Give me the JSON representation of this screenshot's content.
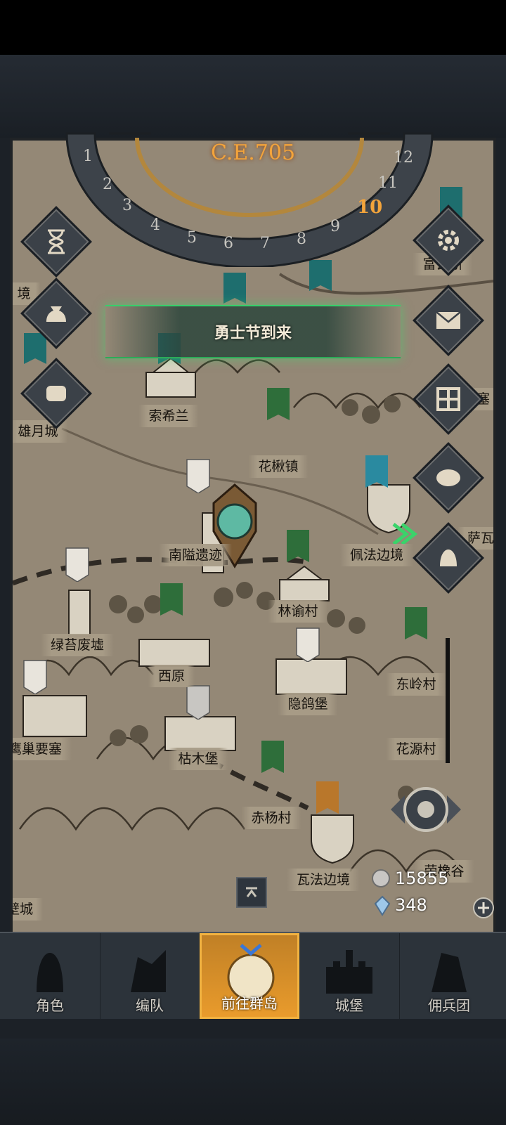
{
  "header": {
    "year": "C.E.705",
    "months": [
      "1",
      "2",
      "3",
      "4",
      "5",
      "6",
      "7",
      "8",
      "9",
      "10",
      "11",
      "12"
    ],
    "current_month": "10"
  },
  "event": {
    "title": "勇士节到来"
  },
  "places": [
    {
      "id": "fu_shi",
      "name": "富瓦斯"
    },
    {
      "id": "jing",
      "name": "境"
    },
    {
      "id": "suo_xi_lan",
      "name": "索希兰"
    },
    {
      "id": "xiong_yue_cheng",
      "name": "雄月城"
    },
    {
      "id": "yao_sai",
      "name": "要塞"
    },
    {
      "id": "hua_qiu_zhen",
      "name": "花楸镇"
    },
    {
      "id": "nan_yi",
      "name": "南隘遗迹"
    },
    {
      "id": "pei_fa",
      "name": "佩法边境"
    },
    {
      "id": "sa",
      "name": "萨瓦"
    },
    {
      "id": "lin_yu",
      "name": "林谕村"
    },
    {
      "id": "lv_tai",
      "name": "绿苔废墟"
    },
    {
      "id": "xi_yuan",
      "name": "西原"
    },
    {
      "id": "dong_ling",
      "name": "东岭村"
    },
    {
      "id": "yin_ge",
      "name": "隐鸽堡"
    },
    {
      "id": "ying_chao",
      "name": "鹰巢要塞"
    },
    {
      "id": "ku_mu",
      "name": "枯木堡"
    },
    {
      "id": "hua_yuan",
      "name": "花源村"
    },
    {
      "id": "chi_yang",
      "name": "赤杨村"
    },
    {
      "id": "wa_fa",
      "name": "瓦法边境"
    },
    {
      "id": "rong_xiang",
      "name": "荣橡谷"
    },
    {
      "id": "bi_cheng",
      "name": "壁城"
    }
  ],
  "resources": {
    "silver": "15855",
    "crystal": "348"
  },
  "nav": [
    {
      "label": "角色",
      "icon": "knight-helmet-icon"
    },
    {
      "label": "编队",
      "icon": "formation-icon"
    },
    {
      "label": "前往群岛",
      "icon": "globe-icon"
    },
    {
      "label": "城堡",
      "icon": "castle-icon"
    },
    {
      "label": "佣兵团",
      "icon": "mercenary-icon"
    }
  ],
  "colors": {
    "accent": "#e99b2c",
    "event_glow": "#37d06b",
    "map": "#948876"
  }
}
